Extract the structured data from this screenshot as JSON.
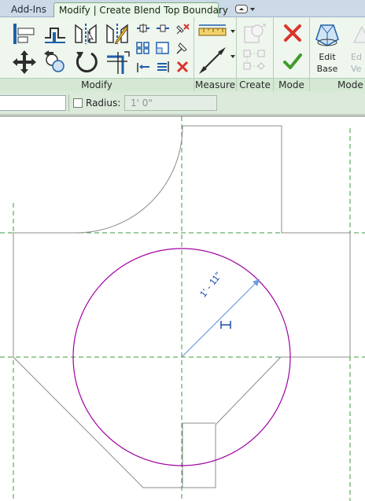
{
  "tabs": {
    "addins": "Add-Ins",
    "active": "Modify | Create Blend Top Boundary"
  },
  "ribbon": {
    "panels": {
      "modify": "Modify",
      "measure": "Measure",
      "create": "Create",
      "mode": "Mode",
      "mode2": "Mode"
    },
    "edit_base": {
      "line1": "Edit",
      "line2": "Base"
    },
    "icons": {
      "align": "align-icon",
      "offset": "offset-icon",
      "mirror_axis": "mirror-pick-axis-icon",
      "mirror_draw": "mirror-draw-axis-icon",
      "move": "move-icon",
      "copy": "copy-icon",
      "rotate": "rotate-icon",
      "trim": "trim-extend-corner-icon",
      "split": "split-element-icon",
      "split_gap": "split-with-gap-icon",
      "unpin": "unpin-icon",
      "pin": "pin-icon",
      "array": "array-icon",
      "scale": "scale-icon",
      "trim_single": "trim-extend-single-icon",
      "trim_multiple": "trim-extend-multiple-icon",
      "delete": "delete-icon",
      "aligned_dimension": "aligned-dimension-icon",
      "measure": "measure-between-references-icon",
      "create_similar": "create-similar-icon",
      "create_group": "create-group-icon",
      "cancel_edit_mode": "cancel-edit-mode-icon",
      "finish_edit_mode": "finish-edit-mode-icon",
      "edit_base": "edit-base-icon"
    },
    "colors": {
      "cancel": "#d9342b",
      "finish": "#3f9b2a",
      "tool_blue": "#1f5fa8"
    }
  },
  "options_bar": {
    "radius_checkbox_checked": false,
    "radius_label": "Radius:",
    "radius_value": "1'  0\""
  },
  "canvas": {
    "dimension_text": "1' - 11\"",
    "colors": {
      "circle": "#a000a0",
      "reference_planes": "#3c9c3c",
      "sketch_lines": "#8c8c8c",
      "dimension": "#1a4bb0"
    }
  }
}
